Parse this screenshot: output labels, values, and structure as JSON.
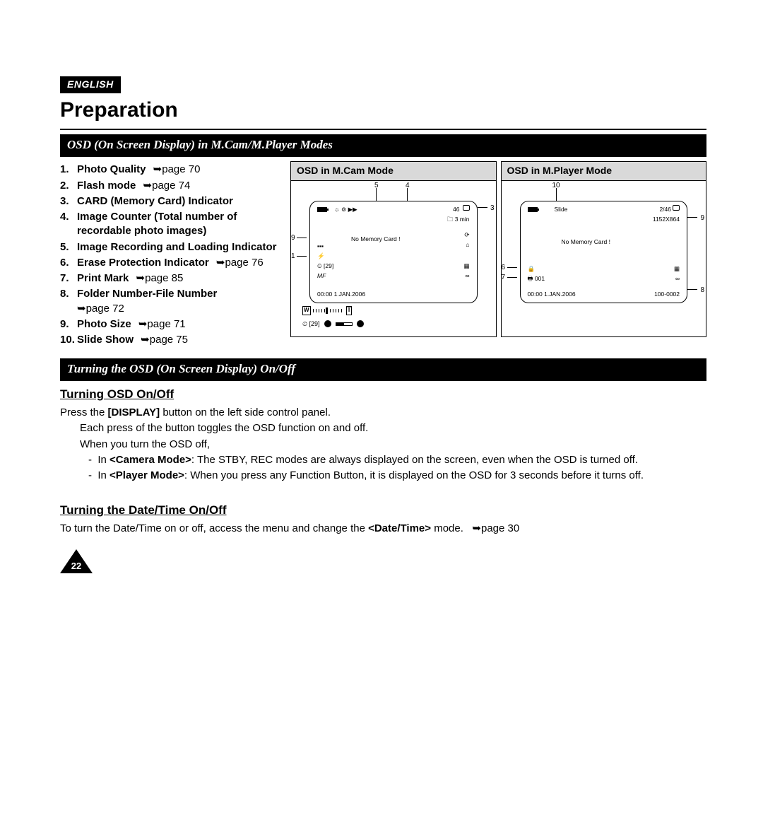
{
  "lang": "ENGLISH",
  "title": "Preparation",
  "section1_bar": "OSD (On Screen Display) in M.Cam/M.Player Modes",
  "callouts": [
    {
      "label": "Photo Quality",
      "pg": "page 70"
    },
    {
      "label": "Flash mode",
      "pg": "page 74"
    },
    {
      "label": "CARD (Memory Card) Indicator",
      "pg": ""
    },
    {
      "label": "Image Counter (Total number of recordable photo images)",
      "pg": ""
    },
    {
      "label": "Image Recording and Loading Indicator",
      "pg": ""
    },
    {
      "label": "Erase Protection Indicator",
      "pg": "page 76"
    },
    {
      "label": "Print Mark",
      "pg": "page 85"
    },
    {
      "label": "Folder Number-File Number",
      "pg": "page 72"
    },
    {
      "label": "Photo Size",
      "pg": "page 71"
    },
    {
      "label": "Slide Show",
      "pg": "page 75"
    }
  ],
  "panelA": {
    "title": "OSD in M.Cam Mode",
    "nums": [
      "5",
      "4",
      "3",
      "9",
      "1"
    ],
    "noCard": "No Memory Card !",
    "count46": "46",
    "min3": "3 min",
    "rec29a": "[29]",
    "mf": "MF",
    "datetime": "00:00  1.JAN.2006",
    "rec29b": "[29]",
    "w": "W",
    "t": "T"
  },
  "panelB": {
    "title": "OSD in M.Player Mode",
    "nums": [
      "10",
      "9",
      "6",
      "7",
      "8"
    ],
    "slide": "Slide",
    "ratio": "2/46",
    "size": "1152X864",
    "noCard": "No Memory Card !",
    "p001": "001",
    "datetime": "00:00  1.JAN.2006",
    "folder": "100-0002"
  },
  "section2_bar": "Turning the OSD (On Screen Display) On/Off",
  "sub1": "Turning OSD On/Off",
  "body1_a": "Press the ",
  "body1_btn": "[DISPLAY]",
  "body1_b": " button on the left side control panel.",
  "body2": "Each press of the button toggles the OSD function on and off.",
  "body3": "When you turn the OSD off,",
  "body4_a": "In ",
  "body4_m": "<Camera Mode>",
  "body4_b": ": The STBY, REC modes are always displayed on the screen, even when the OSD is turned off.",
  "body5_a": "In ",
  "body5_m": "<Player Mode>",
  "body5_b": ": When you press any Function Button, it is displayed on the OSD for 3 seconds before it turns off.",
  "sub2": "Turning the Date/Time On/Off",
  "body6_a": "To turn the Date/Time on or off, access the menu and change the ",
  "body6_m": "<Date/Time>",
  "body6_b": " mode. ",
  "body6_pg": "➥page 30",
  "page_num": "22"
}
